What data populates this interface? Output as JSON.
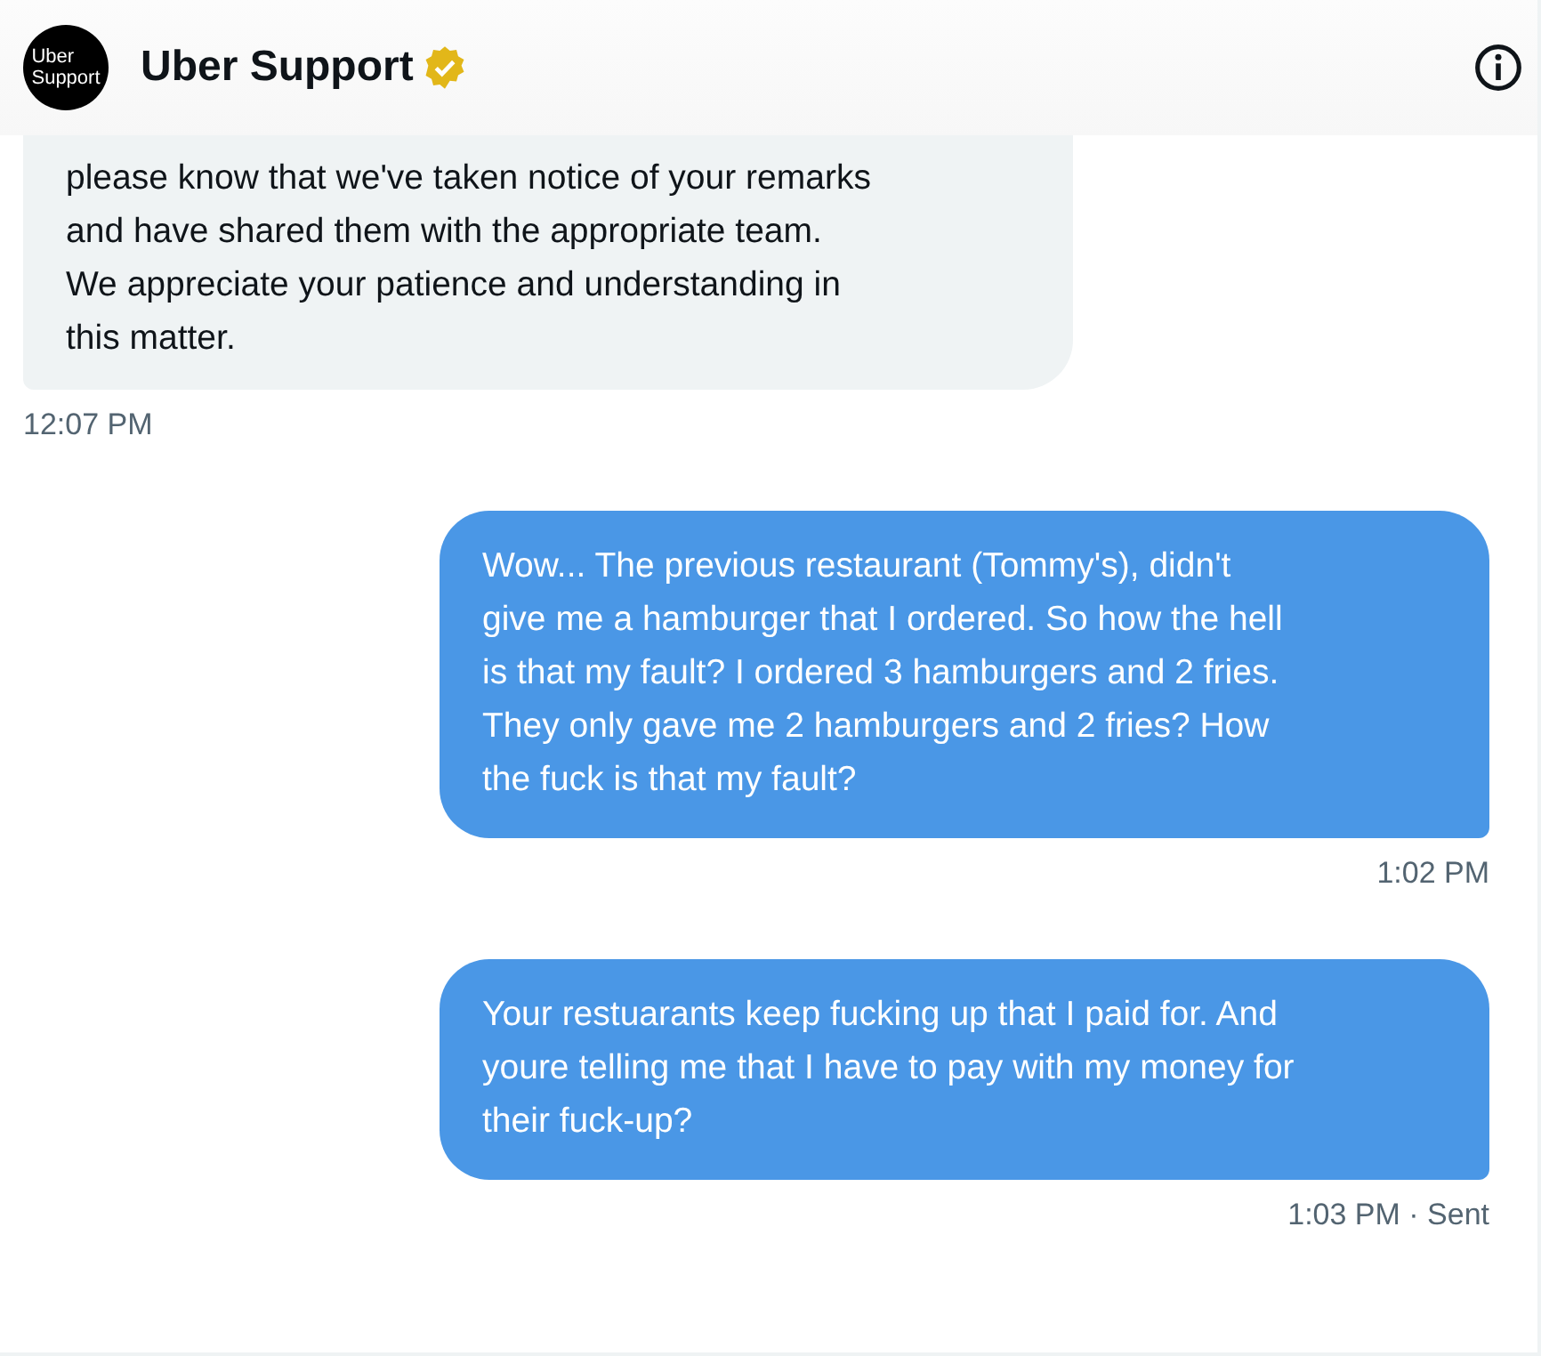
{
  "header": {
    "avatar_text": "Uber\nSupport",
    "name": "Uber Support",
    "verified": true
  },
  "messages": [
    {
      "kind": "received",
      "text": "please know that we've taken notice of your remarks\nand have shared them with the appropriate team.\nWe appreciate your patience and understanding in\nthis matter.",
      "time": "12:07 PM"
    },
    {
      "kind": "sent",
      "text": "Wow... The previous restaurant (Tommy's), didn't\ngive me a hamburger that I ordered. So how the hell\nis that my fault? I ordered 3 hamburgers and 2 fries.\nThey only gave me 2 hamburgers and 2 fries? How\nthe fuck is that my fault?",
      "time": "1:02 PM"
    },
    {
      "kind": "sent",
      "text": "Your restuarants keep fucking up that I paid for. And\nyoure telling me that I have to pay with my money for\ntheir fuck-up?",
      "time": "1:03 PM · Sent"
    }
  ]
}
